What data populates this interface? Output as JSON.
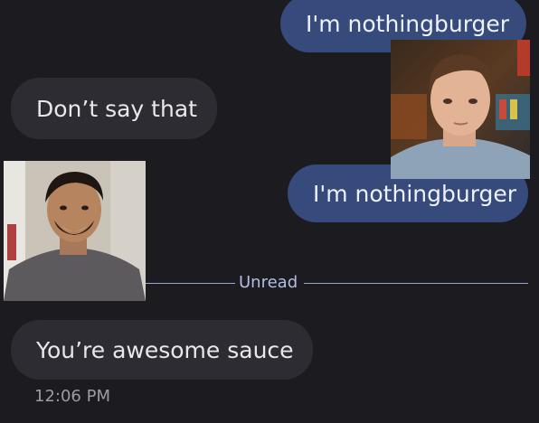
{
  "messages": [
    {
      "direction": "outgoing",
      "text": "I'm nothingburger"
    },
    {
      "direction": "incoming",
      "text": "Don’t say that"
    },
    {
      "direction": "outgoing",
      "text": "I'm nothingburger"
    },
    {
      "direction": "incoming",
      "text": "You’re awesome sauce"
    }
  ],
  "unread_divider": {
    "label": "Unread"
  },
  "timestamp": "12:06 PM",
  "colors": {
    "background": "#1b1b20",
    "outgoing_bubble": "#364a7c",
    "incoming_bubble": "#2c2c32",
    "divider": "#9aa6d8"
  }
}
